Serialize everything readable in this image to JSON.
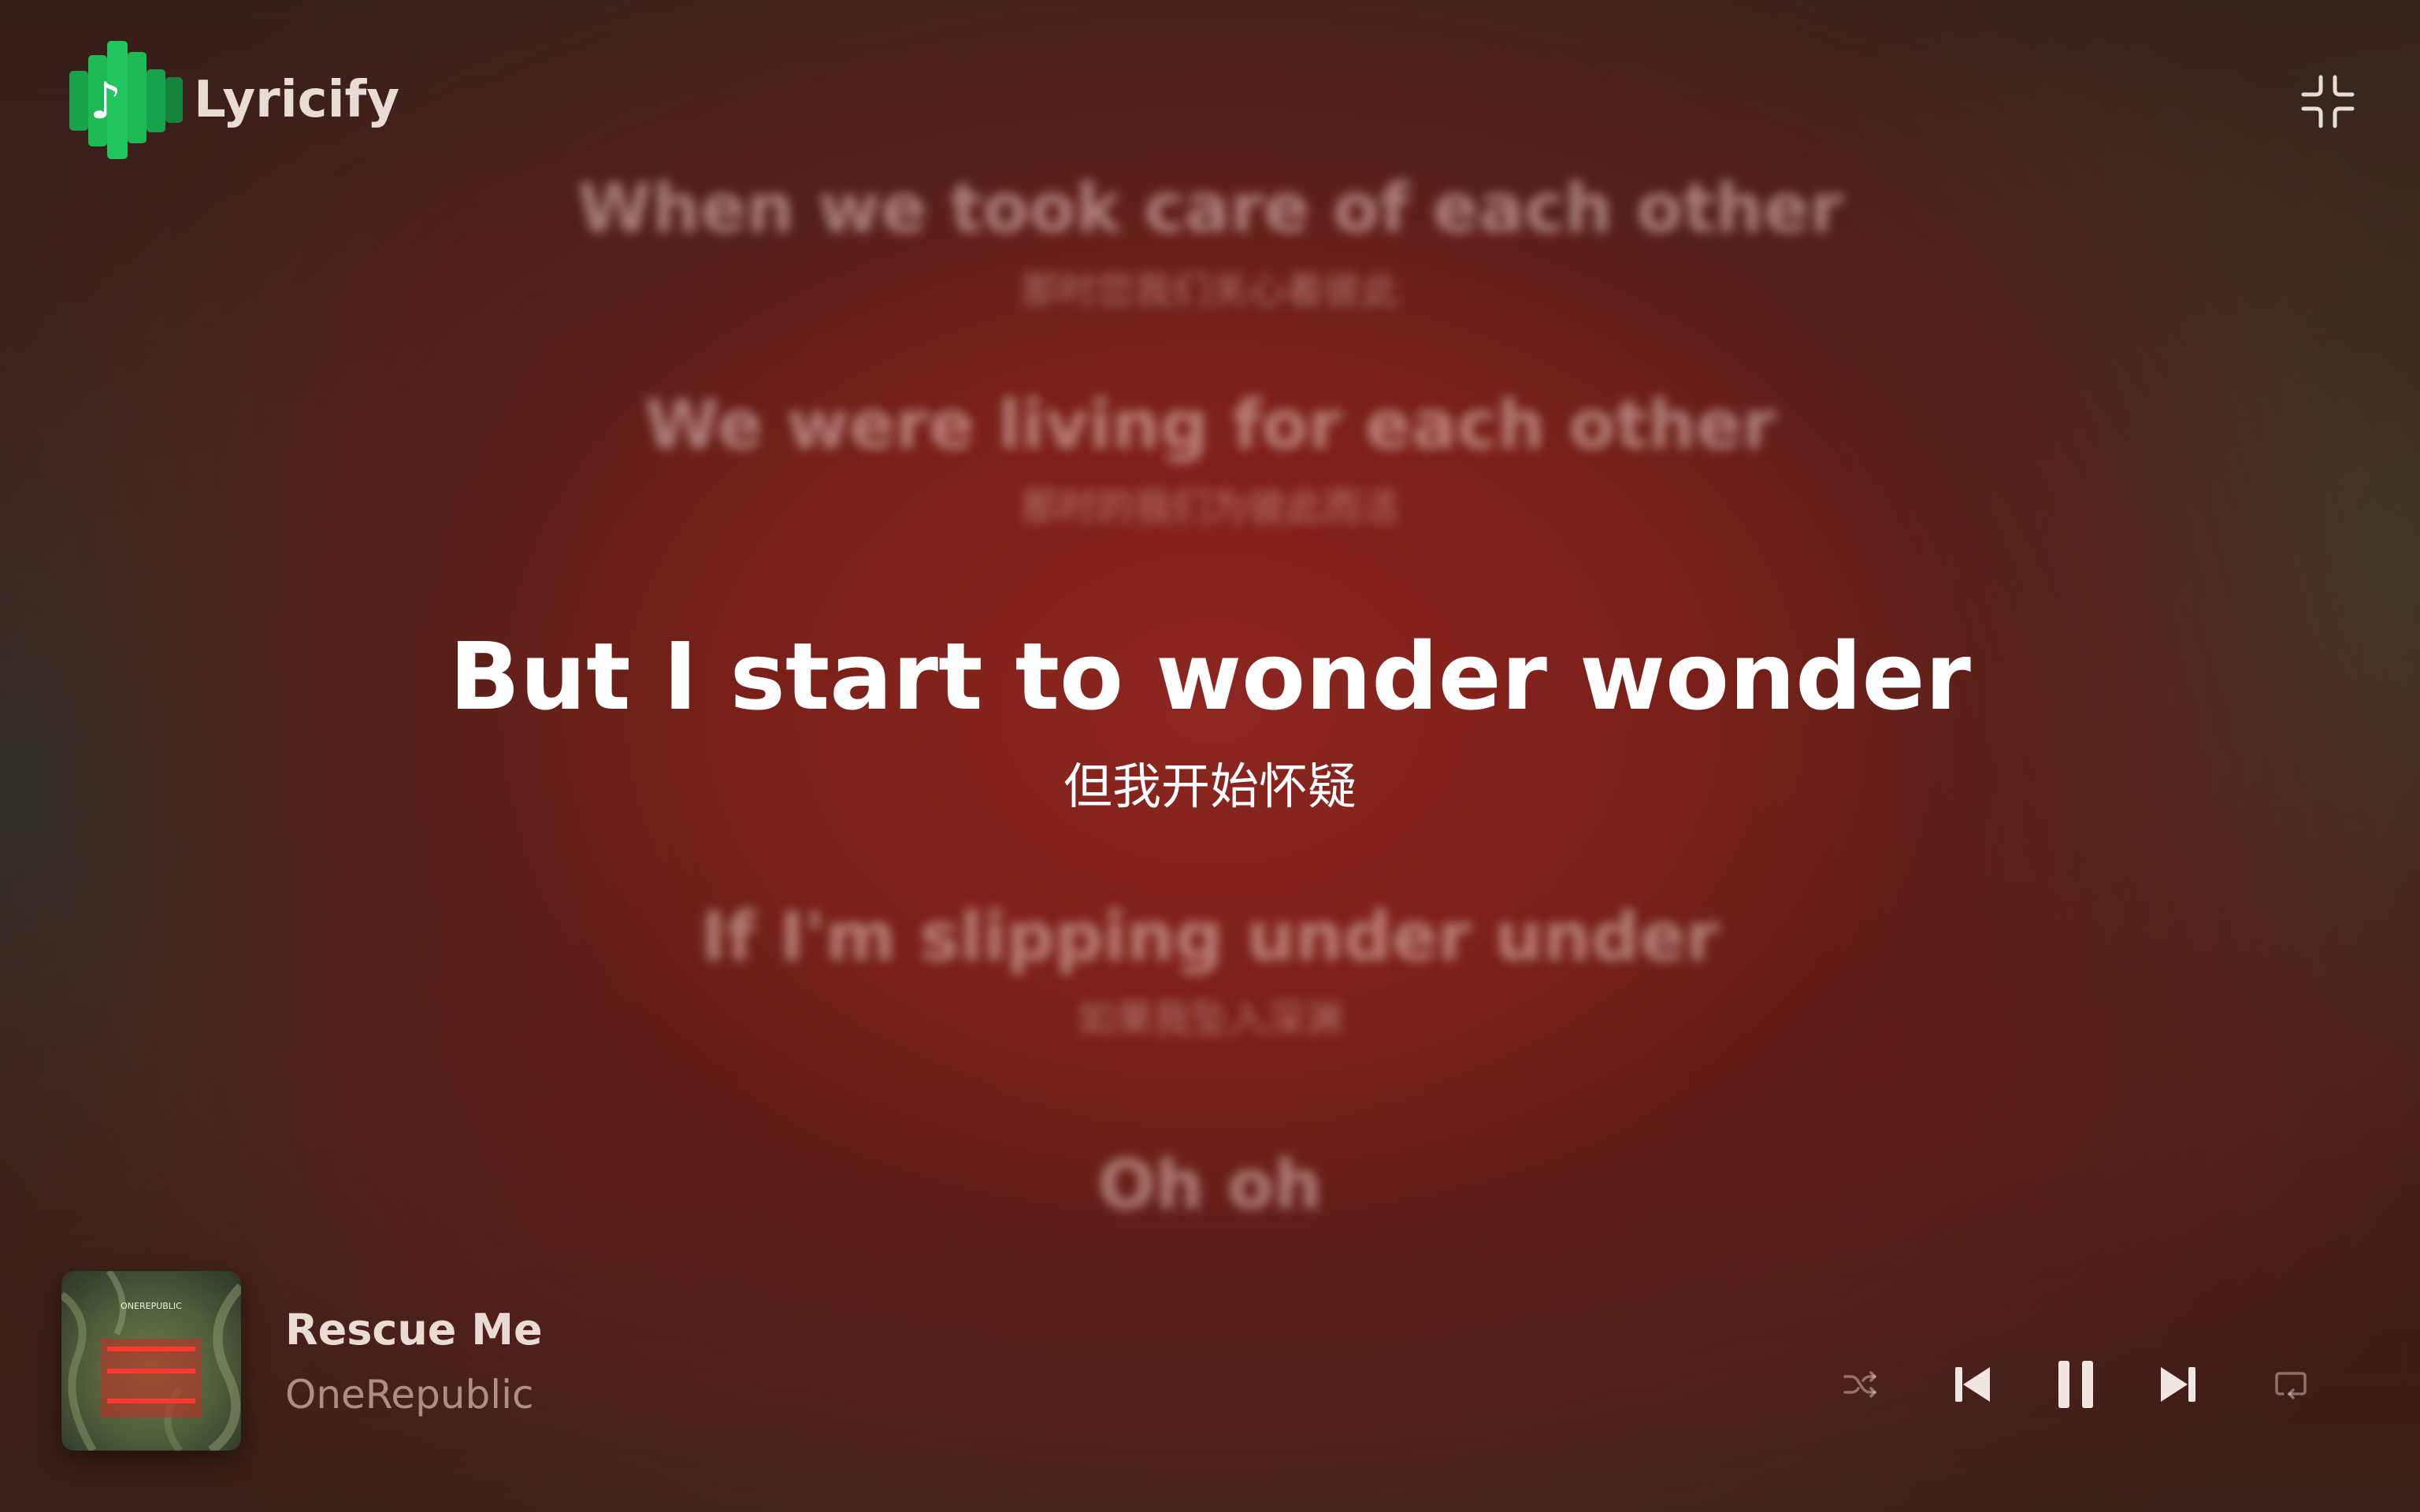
{
  "app": {
    "name": "Lyricify"
  },
  "lyrics": [
    {
      "en": "When we took care of each other",
      "zh": "那时您我们关心着彼此",
      "active": false
    },
    {
      "en": "We were living for each other",
      "zh": "那时的我们为彼此而活",
      "active": false
    },
    {
      "en": "But I start to wonder wonder",
      "zh": "但我开始怀疑",
      "active": true
    },
    {
      "en": "If I'm slipping under under",
      "zh": "如果我坠入深渊",
      "active": false
    },
    {
      "en": "Oh oh",
      "zh": "",
      "active": false
    }
  ],
  "now_playing": {
    "title": "Rescue Me",
    "artist": "OneRepublic",
    "cover_text": "ONEREPUBLIC"
  },
  "controls": {
    "shuffle_icon": "shuffle-icon",
    "previous_icon": "skip-previous-icon",
    "play_state": "playing",
    "pause_icon": "pause-icon",
    "next_icon": "skip-next-icon",
    "repeat_icon": "repeat-icon"
  },
  "colors": {
    "background_accent": "#8e2620",
    "logo_green": "#1db954",
    "active_text": "#ffffff",
    "inactive_text": "#ebcdc6"
  }
}
